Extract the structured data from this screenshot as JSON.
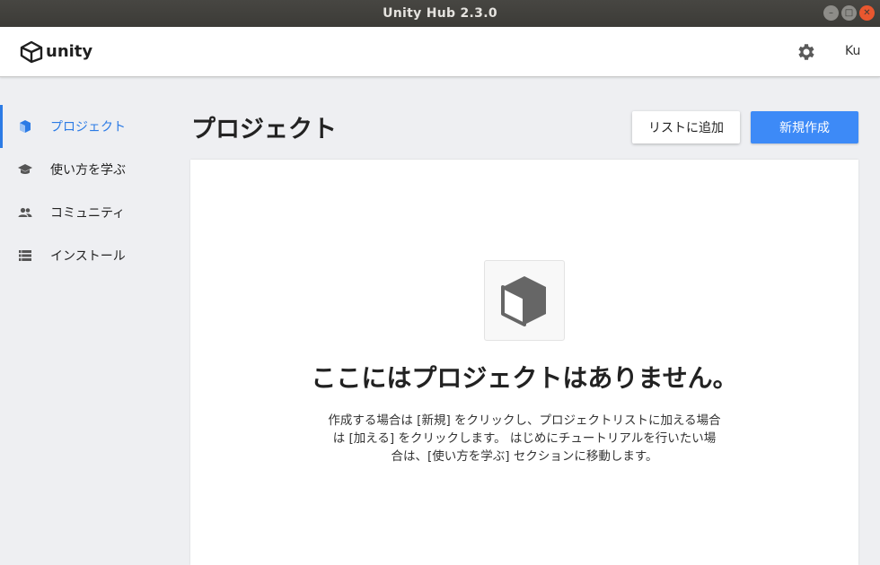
{
  "window": {
    "title": "Unity Hub 2.3.0"
  },
  "header": {
    "logo_text": "unity",
    "account_initials": "Ku"
  },
  "sidebar": {
    "items": [
      {
        "label": "プロジェクト",
        "icon": "cube-icon",
        "active": true
      },
      {
        "label": "使い方を学ぶ",
        "icon": "graduation-cap-icon",
        "active": false
      },
      {
        "label": "コミュニティ",
        "icon": "people-icon",
        "active": false
      },
      {
        "label": "インストール",
        "icon": "list-icon",
        "active": false
      }
    ]
  },
  "main": {
    "title": "プロジェクト",
    "add_button_label": "リストに追加",
    "new_button_label": "新規作成",
    "empty_state": {
      "icon": "cube-icon",
      "title": "ここにはプロジェクトはありません。",
      "description": "作成する場合は [新規] をクリックし、プロジェクトリストに加える場合は [加える] をクリックします。 はじめにチュートリアルを行いたい場合は、[使い方を学ぶ] セクションに移動します。"
    }
  },
  "colors": {
    "accent": "#2c7be5",
    "primary_button": "#3d8af7",
    "close_button": "#e9572f"
  }
}
